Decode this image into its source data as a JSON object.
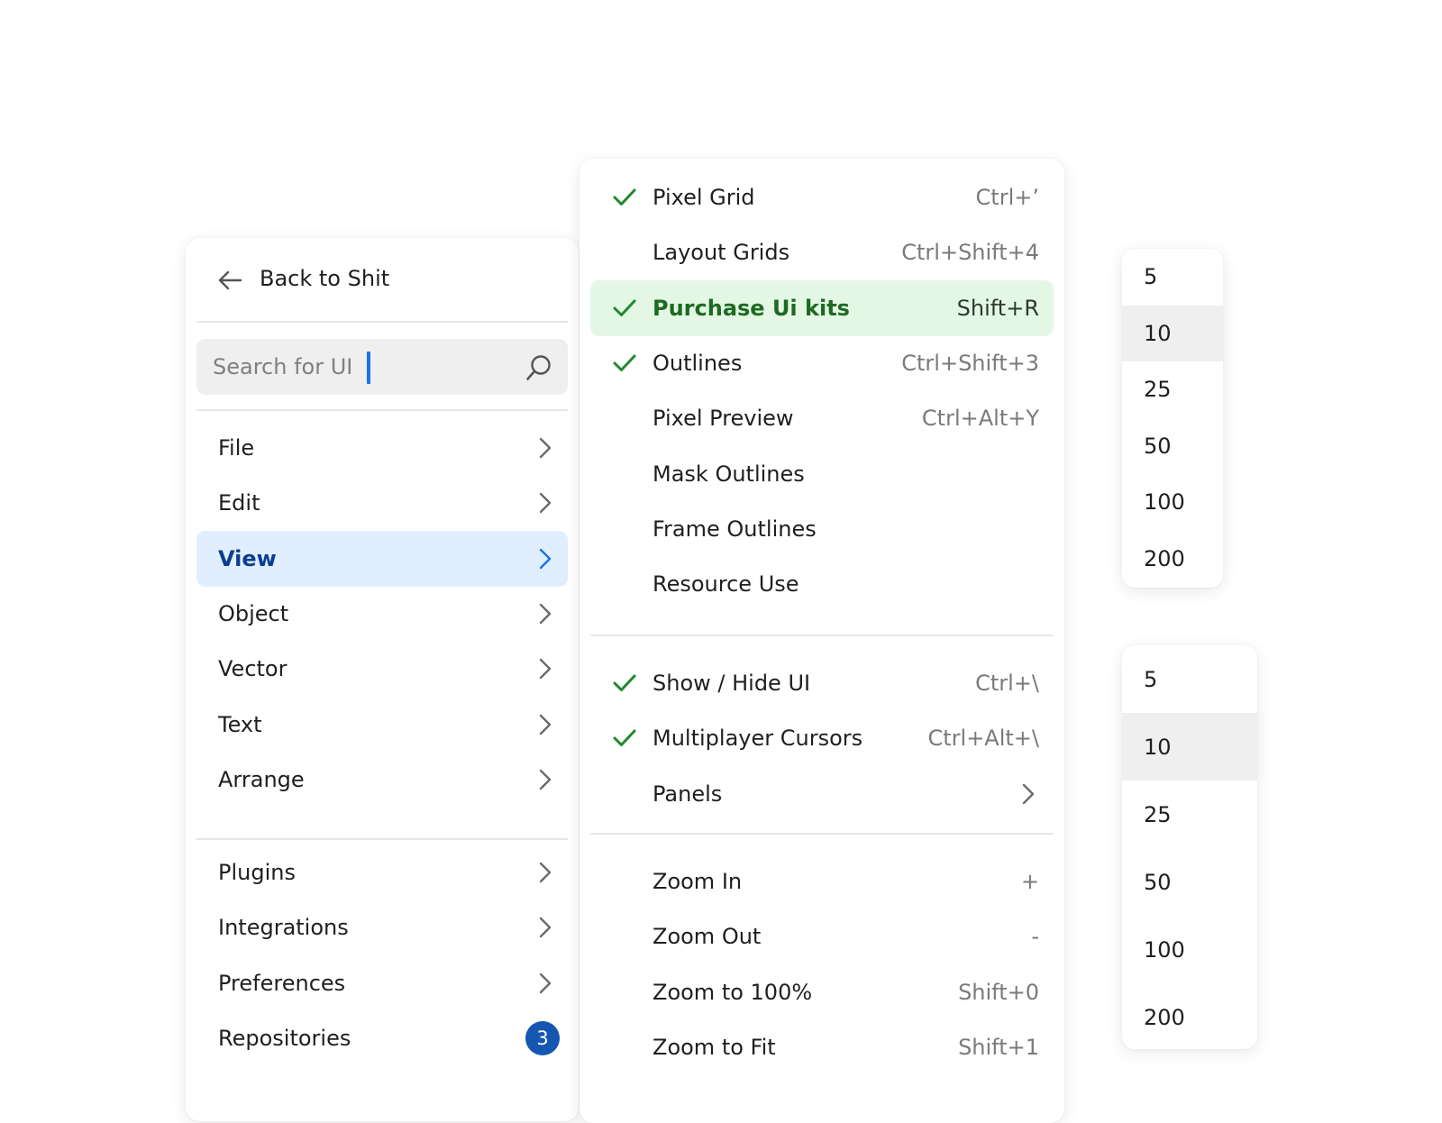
{
  "main_menu": {
    "back_label": "Back to Shit",
    "search_placeholder": "Search for UI",
    "items": [
      {
        "label": "File"
      },
      {
        "label": "Edit"
      },
      {
        "label": "View"
      },
      {
        "label": "Object"
      },
      {
        "label": "Vector"
      },
      {
        "label": "Text"
      },
      {
        "label": "Arrange"
      }
    ],
    "more_items": [
      {
        "label": "Plugins"
      },
      {
        "label": "Integrations"
      },
      {
        "label": "Preferences"
      },
      {
        "label": "Repositories",
        "badge": "3"
      }
    ]
  },
  "view_submenu": {
    "group1": [
      {
        "label": "Pixel Grid",
        "shortcut": "Ctrl+’",
        "checked": true
      },
      {
        "label": "Layout Grids",
        "shortcut": "Ctrl+Shift+4",
        "checked": false
      },
      {
        "label": "Purchase Ui kits",
        "shortcut": "Shift+R",
        "checked": true
      },
      {
        "label": "Outlines",
        "shortcut": "Ctrl+Shift+3",
        "checked": true
      },
      {
        "label": "Pixel Preview",
        "shortcut": "Ctrl+Alt+Y",
        "checked": false
      },
      {
        "label": "Mask Outlines",
        "shortcut": "",
        "checked": false
      },
      {
        "label": "Frame Outlines",
        "shortcut": "",
        "checked": false
      },
      {
        "label": "Resource Use",
        "shortcut": "",
        "checked": false
      }
    ],
    "group2": [
      {
        "label": "Show / Hide UI",
        "shortcut": "Ctrl+\\",
        "checked": true
      },
      {
        "label": "Multiplayer Cursors",
        "shortcut": "Ctrl+Alt+\\",
        "checked": true
      },
      {
        "label": "Panels",
        "shortcut": "",
        "checked": false
      }
    ],
    "group3": [
      {
        "label": "Zoom In",
        "shortcut": "+"
      },
      {
        "label": "Zoom Out",
        "shortcut": "-"
      },
      {
        "label": "Zoom to 100%",
        "shortcut": "Shift+0"
      },
      {
        "label": "Zoom to Fit",
        "shortcut": "Shift+1"
      }
    ]
  },
  "number_list_1": {
    "values": [
      "5",
      "10",
      "25",
      "50",
      "100",
      "200"
    ],
    "selected": "10"
  },
  "number_list_2": {
    "values": [
      "5",
      "10",
      "25",
      "50",
      "100",
      "200"
    ],
    "selected": "10"
  },
  "colors": {
    "accent_blue": "#1a73e8",
    "active_bg": "#e1eefe",
    "highlight_bg": "#e3f7e4",
    "check_green": "#1f8a2b",
    "badge_bg": "#1557b0"
  }
}
